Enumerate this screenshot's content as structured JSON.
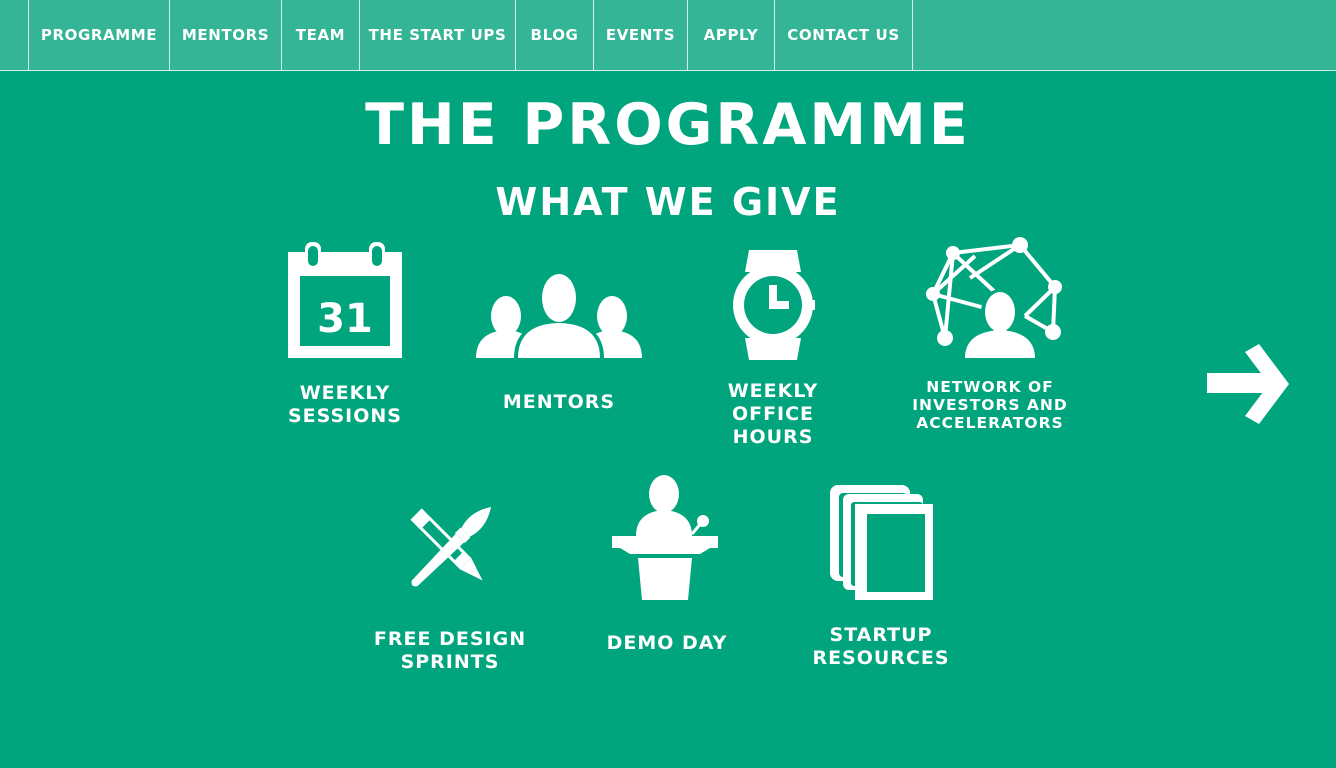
{
  "nav": {
    "items": [
      {
        "label": "PROGRAMME"
      },
      {
        "label": "MENTORS"
      },
      {
        "label": "TEAM"
      },
      {
        "label": "THE START UPS"
      },
      {
        "label": "BLOG"
      },
      {
        "label": "EVENTS"
      },
      {
        "label": "APPLY"
      },
      {
        "label": "CONTACT US"
      }
    ]
  },
  "main": {
    "title": "THE PROGRAMME",
    "subtitle": "WHAT WE GIVE",
    "features": [
      {
        "label": "WEEKLY\nSESSIONS",
        "icon": "calendar-icon",
        "calendar_day": "31"
      },
      {
        "label": "MENTORS",
        "icon": "people-icon"
      },
      {
        "label": "WEEKLY\nOFFICE HOURS",
        "icon": "watch-icon"
      },
      {
        "label": "NETWORK OF\nINVESTORS AND\nACCELERATORS",
        "icon": "network-icon"
      },
      {
        "label": "FREE DESIGN\nSPRINTS",
        "icon": "brush-pencil-icon"
      },
      {
        "label": "DEMO DAY",
        "icon": "podium-icon"
      },
      {
        "label": "STARTUP\nRESOURCES",
        "icon": "documents-icon"
      }
    ],
    "next_icon": "arrow-right-icon"
  },
  "colors": {
    "background": "#00a47d",
    "nav_background": "#33b596",
    "text": "#ffffff"
  }
}
